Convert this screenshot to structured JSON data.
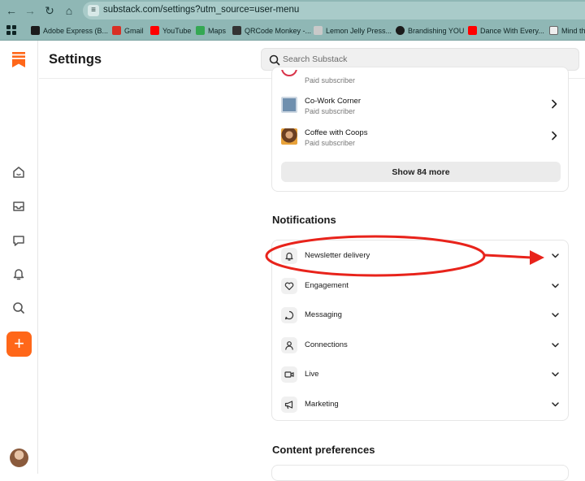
{
  "browser": {
    "url": "substack.com/settings?utm_source=user-menu",
    "bookmarks": [
      {
        "label": "Adobe Express (B...",
        "color": "#1b1b1b"
      },
      {
        "label": "Gmail",
        "color": "#d93025"
      },
      {
        "label": "YouTube",
        "color": "#ff0000"
      },
      {
        "label": "Maps",
        "color": "#34a853"
      },
      {
        "label": "QRCode Monkey -...",
        "color": "#333333"
      },
      {
        "label": "Lemon Jelly Press...",
        "color": "#c9c9c9"
      },
      {
        "label": "Brandishing YOU",
        "color": "#1b1b1b"
      },
      {
        "label": "Dance With Every...",
        "color": "#ff0000"
      },
      {
        "label": "Mind the",
        "color": "#eeeeee"
      }
    ]
  },
  "header": {
    "title": "Settings",
    "search_placeholder": "Search Substack"
  },
  "subscriptions": {
    "partial_status": "Paid subscriber",
    "items": [
      {
        "name": "Co-Work Corner",
        "status": "Paid subscriber"
      },
      {
        "name": "Coffee with Coops",
        "status": "Paid subscriber"
      }
    ],
    "show_more_label": "Show 84 more"
  },
  "notifications": {
    "heading": "Notifications",
    "items": [
      {
        "label": "Newsletter delivery",
        "icon": "bell-icon"
      },
      {
        "label": "Engagement",
        "icon": "heart-icon"
      },
      {
        "label": "Messaging",
        "icon": "chat-bubble-icon"
      },
      {
        "label": "Connections",
        "icon": "person-icon"
      },
      {
        "label": "Live",
        "icon": "video-camera-icon"
      },
      {
        "label": "Marketing",
        "icon": "megaphone-icon"
      }
    ]
  },
  "content_preferences": {
    "heading": "Content preferences"
  },
  "colors": {
    "brand": "#ff6719",
    "annotation": "#e8231b"
  }
}
